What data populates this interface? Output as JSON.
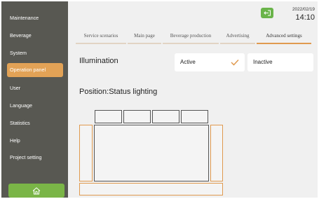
{
  "sidebar": {
    "items": [
      {
        "label": "Maintenance"
      },
      {
        "label": "Beverage"
      },
      {
        "label": "System"
      },
      {
        "label": "Operation panel",
        "active": true
      },
      {
        "label": "User"
      },
      {
        "label": "Language"
      },
      {
        "label": "Statistics"
      },
      {
        "label": "Help"
      },
      {
        "label": "Project setting"
      }
    ],
    "home_icon": "home-icon"
  },
  "header": {
    "date": "2022/02/19",
    "time": "14:10",
    "logout_icon": "logout-icon"
  },
  "tabs": [
    {
      "label": "Service scenarios"
    },
    {
      "label": "Main page"
    },
    {
      "label": "Beverage production"
    },
    {
      "label": "Advertising"
    },
    {
      "label": "Advanced settings",
      "active": true
    }
  ],
  "illumination": {
    "label": "Illumination",
    "active_label": "Active",
    "inactive_label": "Inactive",
    "selected": "Active"
  },
  "position": {
    "label": "Position:Status lighting"
  },
  "colors": {
    "sidebar": "#585852",
    "active_nav": "#e2a256",
    "accent": "#e09a4f",
    "green": "#6ab44a",
    "background": "#f0f0f0"
  }
}
